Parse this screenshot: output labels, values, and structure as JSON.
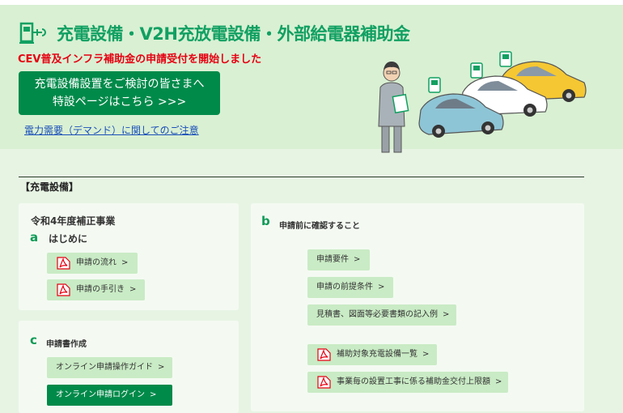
{
  "hero": {
    "title": "充電設備・V2H充放電設備・外部給電器補助金",
    "subtitle": "CEV普及インフラ補助金の申請受付を開始しました",
    "cta_line1": "充電設備設置をご検討の皆さまへ",
    "cta_line2": "特設ページはこちら >>>",
    "notice_link": "電力需要（デマンド）に関してのご注意",
    "accent_color": "#008a4a",
    "title_color": "#11a062"
  },
  "section": {
    "heading": "【充電設備】"
  },
  "card_a": {
    "year": "令和4年度補正事業",
    "letter": "a",
    "heading": "はじめに",
    "buttons": [
      {
        "label": "申請の流れ",
        "icon": "pdf-icon"
      },
      {
        "label": "申請の手引き",
        "icon": "pdf-icon"
      }
    ]
  },
  "card_c": {
    "letter": "c",
    "heading": "申請書作成",
    "buttons": [
      {
        "label": "オンライン申請操作ガイド"
      },
      {
        "label": "オンライン申請ログイン"
      }
    ]
  },
  "card_b": {
    "letter": "b",
    "heading": "申請前に確認すること",
    "buttons": [
      {
        "label": "申請要件"
      },
      {
        "label": "申請の前提条件"
      },
      {
        "label": "見積書、図面等必要書類の記入例"
      },
      {
        "label": "補助対象充電設備一覧",
        "icon": "pdf-icon"
      },
      {
        "label": "事業毎の設置工事に係る補助金交付上限額",
        "icon": "pdf-icon"
      }
    ]
  },
  "chevron": ">"
}
